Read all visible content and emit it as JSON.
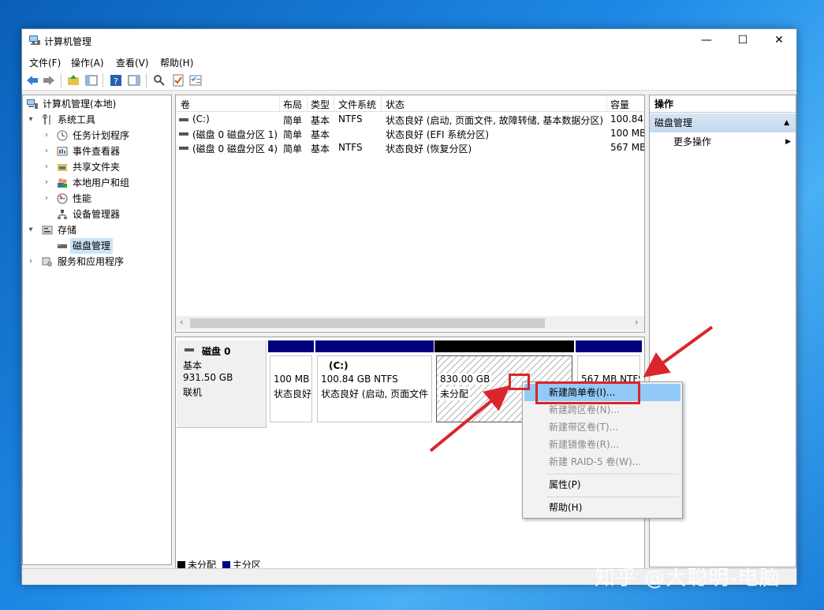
{
  "window": {
    "title": "计算机管理",
    "controls": {
      "minimize": "—",
      "maximize": "☐",
      "close": "✕"
    }
  },
  "menubar": [
    "文件(F)",
    "操作(A)",
    "查看(V)",
    "帮助(H)"
  ],
  "tree": {
    "root": "计算机管理(本地)",
    "system_tools": "系统工具",
    "task_scheduler": "任务计划程序",
    "event_viewer": "事件查看器",
    "shared_folders": "共享文件夹",
    "local_users": "本地用户和组",
    "performance": "性能",
    "device_manager": "设备管理器",
    "storage": "存储",
    "disk_management": "磁盘管理",
    "services": "服务和应用程序"
  },
  "volumes": {
    "columns": [
      "卷",
      "布局",
      "类型",
      "文件系统",
      "状态",
      "容量"
    ],
    "rows": [
      [
        "(C:)",
        "简单",
        "基本",
        "NTFS",
        "状态良好 (启动, 页面文件, 故障转储, 基本数据分区)",
        "100.84"
      ],
      [
        "(磁盘 0 磁盘分区 1)",
        "简单",
        "基本",
        "",
        "状态良好 (EFI 系统分区)",
        "100 MB"
      ],
      [
        "(磁盘 0 磁盘分区 4)",
        "简单",
        "基本",
        "NTFS",
        "状态良好 (恢复分区)",
        "567 MB"
      ]
    ]
  },
  "disk": {
    "name": "磁盘 0",
    "type": "基本",
    "size": "931.50 GB",
    "status": "联机",
    "partitions": [
      {
        "size": "100 MB",
        "status": "状态良好"
      },
      {
        "label": "(C:)",
        "size": "100.84 GB NTFS",
        "status": "状态良好 (启动, 页面文件"
      },
      {
        "size": "830.00 GB",
        "status": "未分配"
      },
      {
        "size": "567 MB NTFS"
      }
    ]
  },
  "legend": {
    "unallocated": "未分配",
    "primary": "主分区"
  },
  "actions": {
    "header": "操作",
    "section": "磁盘管理",
    "more": "更多操作"
  },
  "context_menu": {
    "items": [
      "新建简单卷(I)...",
      "新建跨区卷(N)...",
      "新建带区卷(T)...",
      "新建镜像卷(R)...",
      "新建 RAID-5 卷(W)...",
      "属性(P)",
      "帮助(H)"
    ]
  },
  "watermark": "知乎 @大聪明-电脑",
  "colors": {
    "primary_partition": "#000080",
    "unallocated": "#000000",
    "highlight": "#d9262b",
    "menu_hover": "#91c9f7"
  }
}
